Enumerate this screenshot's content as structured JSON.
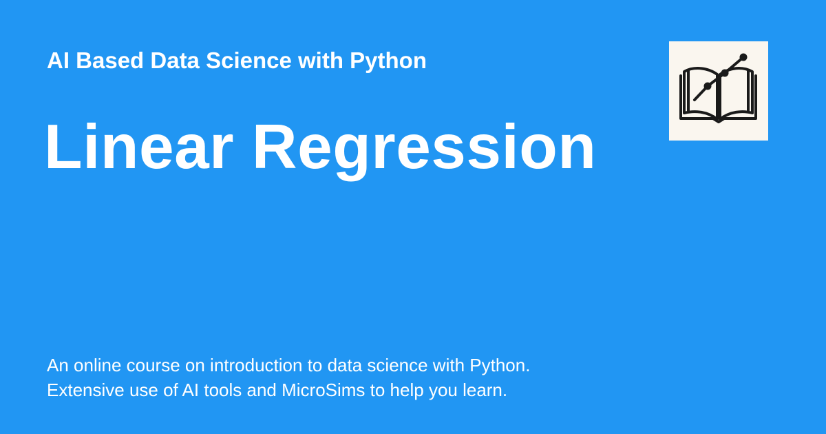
{
  "header": {
    "site_name": "AI Based Data Science with Python"
  },
  "main": {
    "title": "Linear Regression"
  },
  "footer": {
    "description_lines": [
      "An online course on introduction to data science with Python.",
      "Extensive use of AI tools and MicroSims to help you learn."
    ]
  },
  "logo": {
    "icon": "open-book-with-trend-line-icon"
  },
  "colors": {
    "background": "#2196f3",
    "text": "#ffffff",
    "logo_background": "#faf6ef",
    "logo_ink": "#1a1a1a"
  }
}
